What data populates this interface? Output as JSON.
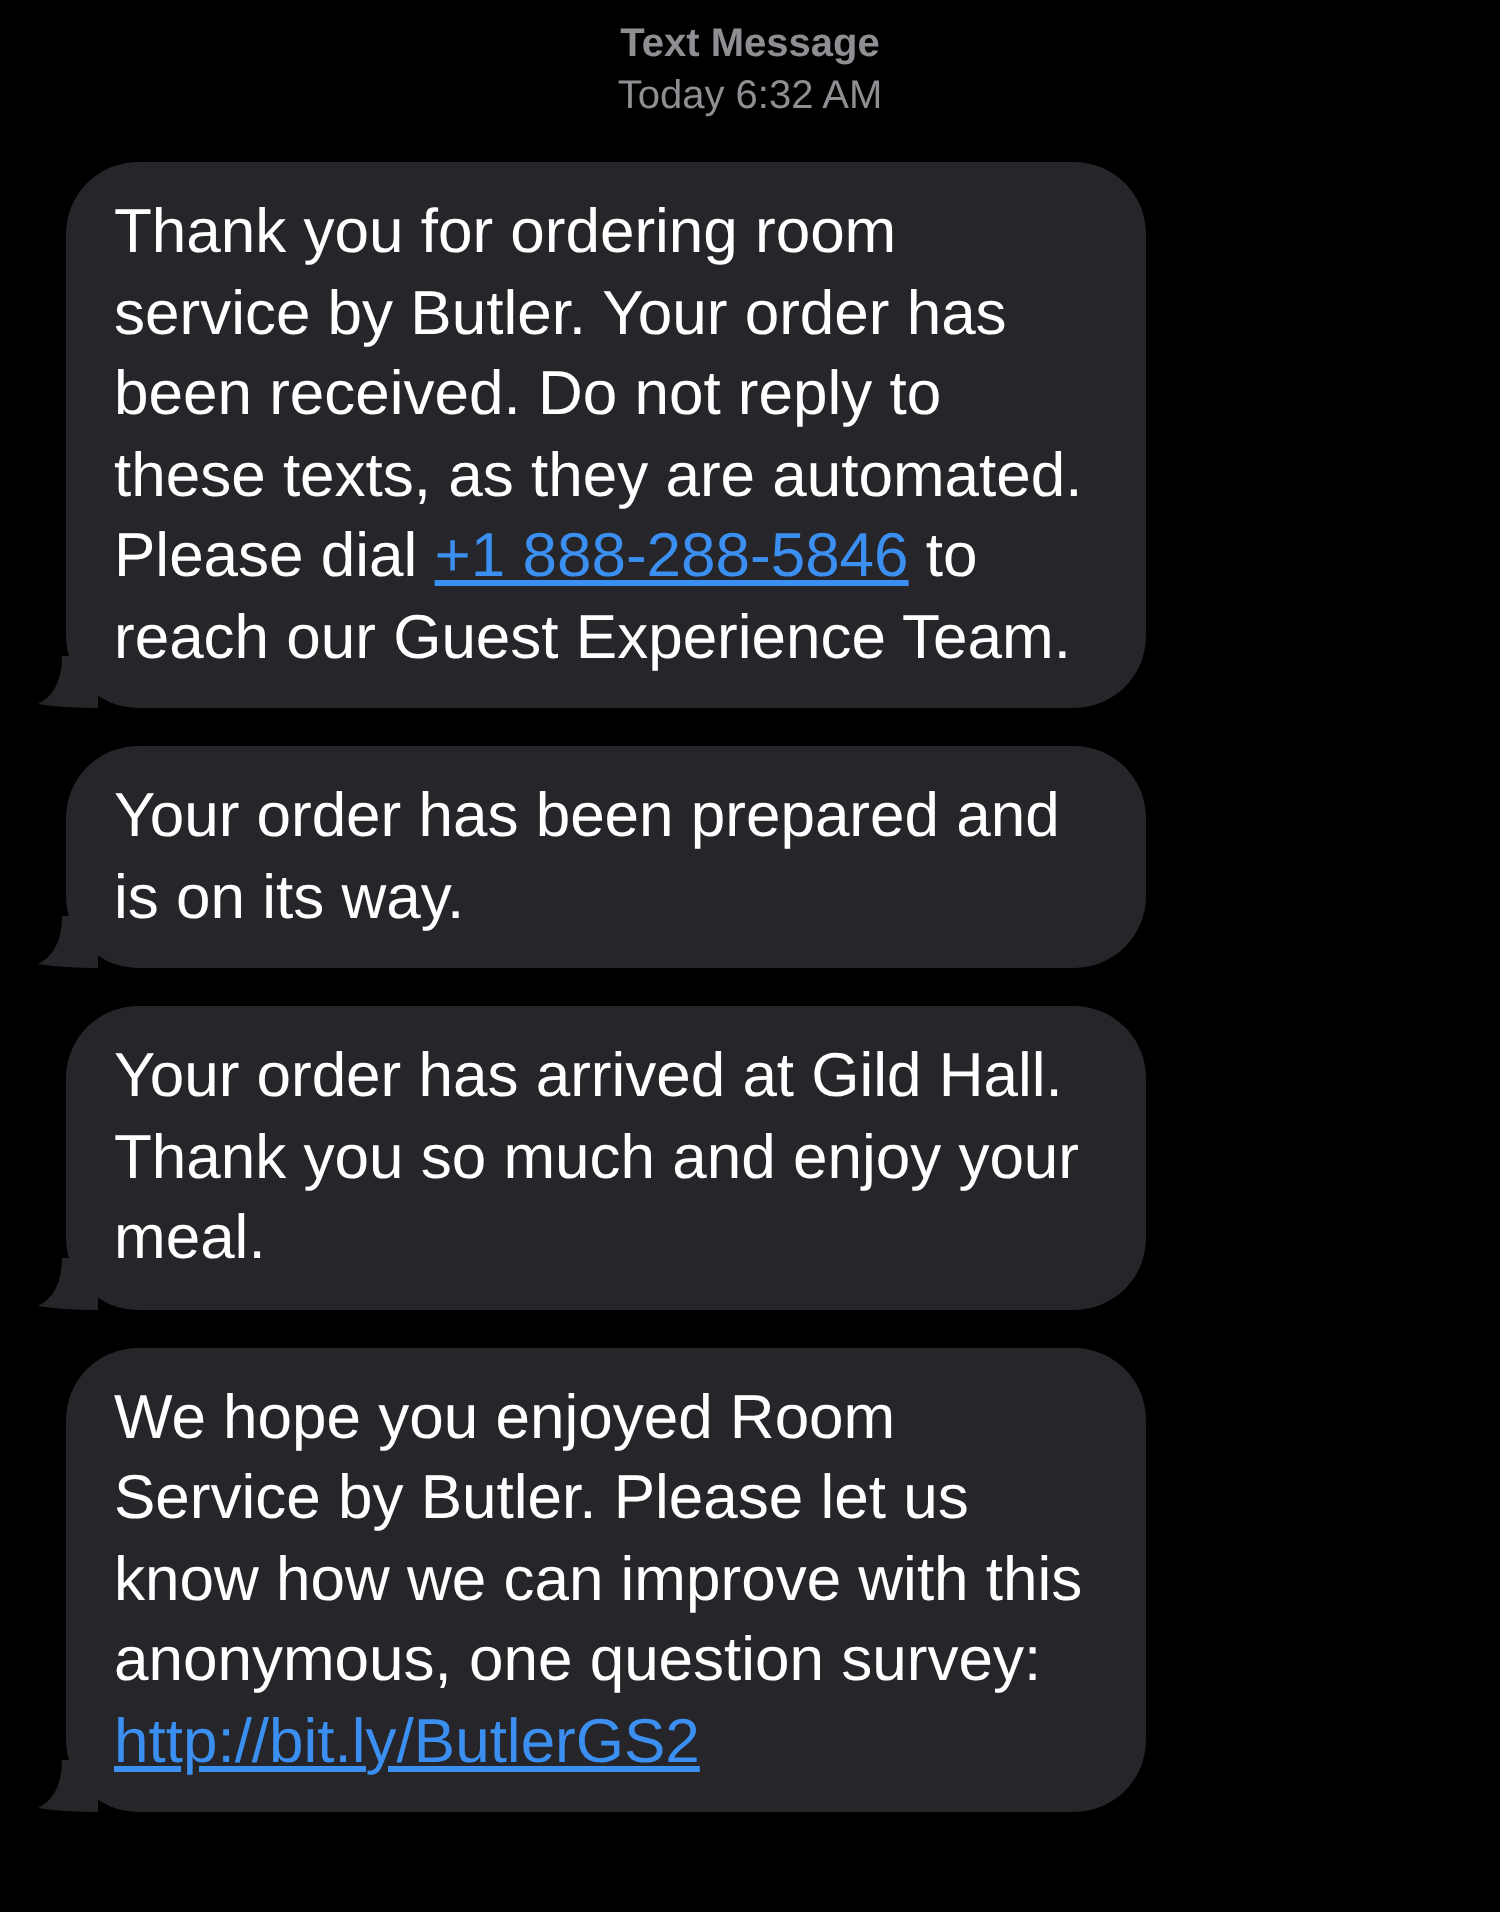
{
  "header": {
    "title": "Text Message",
    "time": "Today 6:32 AM"
  },
  "messages": [
    {
      "parts": [
        {
          "kind": "text",
          "text": "Thank you for ordering room service by Butler. Your order has been received. Do not reply to these texts, as they are automated. Please dial "
        },
        {
          "kind": "link",
          "text": "+1 888-288-5846"
        },
        {
          "kind": "text",
          "text": " to reach our Guest Experience Team."
        }
      ]
    },
    {
      "parts": [
        {
          "kind": "text",
          "text": "Your order has been prepared and is on its way."
        }
      ]
    },
    {
      "parts": [
        {
          "kind": "text",
          "text": "Your order has arrived at Gild Hall. Thank you so much and enjoy your meal."
        }
      ]
    },
    {
      "parts": [
        {
          "kind": "text",
          "text": "We hope you enjoyed Room Service by Butler. Please let us know how we can improve with this anonymous, one question survey: "
        },
        {
          "kind": "link",
          "text": "http://bit.ly/ButlerGS2"
        }
      ]
    }
  ]
}
